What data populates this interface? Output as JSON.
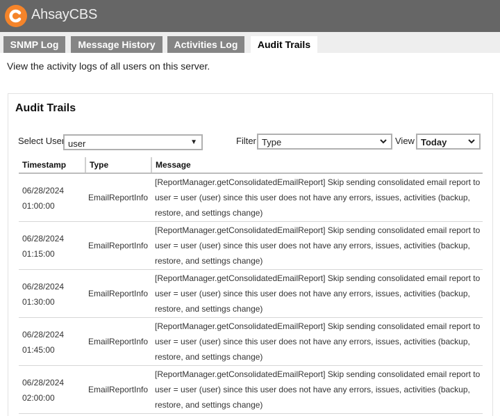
{
  "app": {
    "brand": "AhsayCBS",
    "logo_icon": "ahsay-c-logo-icon"
  },
  "tabs": [
    {
      "label": "SNMP Log",
      "active": false
    },
    {
      "label": "Message History",
      "active": false
    },
    {
      "label": "Activities Log",
      "active": false
    },
    {
      "label": "Audit Trails",
      "active": true
    }
  ],
  "description": "View the activity logs of all users on this server.",
  "panel": {
    "title": "Audit Trails",
    "select_user_label": "Select User",
    "select_user_value": "user",
    "filter_label": "Filter",
    "filter_value": "Type",
    "view_label": "View",
    "view_value": "Today"
  },
  "table": {
    "columns": [
      "Timestamp",
      "Type",
      "Message"
    ],
    "rows": [
      {
        "date": "06/28/2024",
        "time": "01:00:00",
        "type": "EmailReportInfo",
        "message": "[ReportManager.getConsolidatedEmailReport] Skip sending consolidated email report to user = user (user) since this user does not have any errors, issues, activities (backup, restore, and settings change)"
      },
      {
        "date": "06/28/2024",
        "time": "01:15:00",
        "type": "EmailReportInfo",
        "message": "[ReportManager.getConsolidatedEmailReport] Skip sending consolidated email report to user = user (user) since this user does not have any errors, issues, activities (backup, restore, and settings change)"
      },
      {
        "date": "06/28/2024",
        "time": "01:30:00",
        "type": "EmailReportInfo",
        "message": "[ReportManager.getConsolidatedEmailReport] Skip sending consolidated email report to user = user (user) since this user does not have any errors, issues, activities (backup, restore, and settings change)"
      },
      {
        "date": "06/28/2024",
        "time": "01:45:00",
        "type": "EmailReportInfo",
        "message": "[ReportManager.getConsolidatedEmailReport] Skip sending consolidated email report to user = user (user) since this user does not have any errors, issues, activities (backup, restore, and settings change)"
      },
      {
        "date": "06/28/2024",
        "time": "02:00:00",
        "type": "EmailReportInfo",
        "message": "[ReportManager.getConsolidatedEmailReport] Skip sending consolidated email report to user = user (user) since this user does not have any errors, issues, activities (backup, restore, and settings change)"
      }
    ]
  },
  "colors": {
    "header_bg": "#666666",
    "logo_orange": "#f5842a",
    "tab_bg": "#858585",
    "tab_active_bg": "#ffffff",
    "tabbar_bg": "#eeeeee"
  }
}
